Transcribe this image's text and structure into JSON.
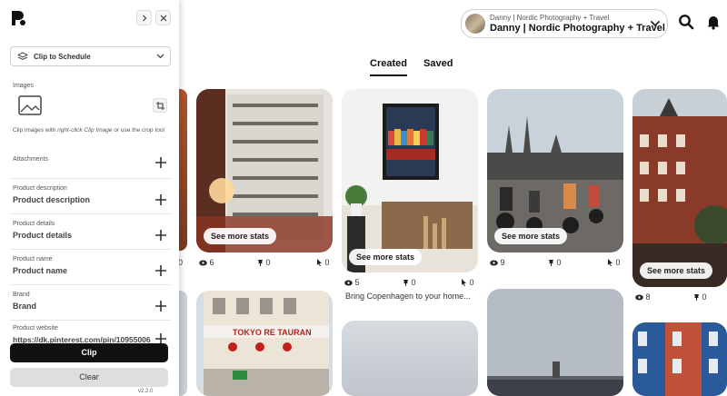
{
  "panel": {
    "select_label": "Clip to Schedule",
    "images_label": "Images",
    "clip_note_pre": "Clip images with ",
    "clip_note_em": "right-click Clip Image",
    "clip_note_post": " or use the crop tool",
    "attachments_label": "Attachments",
    "fields": [
      {
        "label": "Product description",
        "value": "Product description"
      },
      {
        "label": "Product details",
        "value": "Product details"
      },
      {
        "label": "Product name",
        "value": "Product name"
      },
      {
        "label": "Brand",
        "value": "Brand"
      },
      {
        "label": "Product website",
        "value": "https://dk.pinterest.com/pin/109550067..."
      }
    ],
    "clip_button": "Clip",
    "clear_button": "Clear",
    "version": "v2.2.0"
  },
  "header": {
    "account_small": "Danny | Nordic Photography + Travel",
    "account_name": "Danny | Nordic Photography + Travel",
    "search_icon": "search-icon",
    "bell_icon": "bell-icon"
  },
  "tabs": [
    "Created",
    "Saved"
  ],
  "pins": {
    "see_more": "See more stats",
    "p1": {
      "views": "6",
      "saves": "0",
      "clicks": "0"
    },
    "p2": {
      "views": "5",
      "saves": "0",
      "clicks": "0",
      "caption": "Bring Copenhagen to your home..."
    },
    "p3": {
      "views": "9",
      "saves": "0",
      "clicks": "0"
    },
    "p4": {
      "views": "8",
      "saves": "0"
    },
    "p0": {
      "clicks": "0"
    }
  },
  "colors": {
    "accent": "#111111",
    "clear_bg": "#dedede"
  }
}
